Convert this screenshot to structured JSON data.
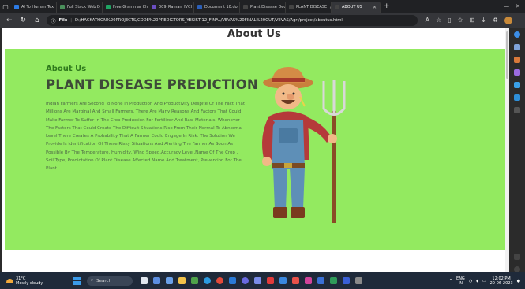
{
  "browser": {
    "tabs": [
      {
        "label": "AI To Human Tex",
        "color": "#2c7be5"
      },
      {
        "label": "Full Stack Web D",
        "color": "#4a8f5b"
      },
      {
        "label": "Free Grammar Ch",
        "color": "#1fa463"
      },
      {
        "label": "009_Raman_IVCH",
        "color": "#6b4ec2"
      },
      {
        "label": "Document 10.do",
        "color": "#2b5fb8"
      },
      {
        "label": "Plant Disease Dec",
        "color": "#444"
      },
      {
        "label": "PLANT DISEASE",
        "color": "#444"
      },
      {
        "label": "ABOUT US",
        "color": "#444"
      }
    ],
    "active_tab": 7,
    "new_tab": "+",
    "address": {
      "label": "File",
      "path": "D:/HACKATHON%20PROJECTS/CODE%20PREDICTORS_YESIST'12_FINAL/VEVAS%20FINAL%20OUT/VEVAS/Agri/project/aboutus.html"
    }
  },
  "page": {
    "title": "About Us",
    "eyebrow": "About Us",
    "headline": "PLANT DISEASE PREDICTION",
    "body": "Indian Farmers Are Second To None In Production And Productivity Despite Of The Fact That Millions Are Marginal And Small Farmers. There Are Many Reasons And Factors That Could Make Farmer To Suffer In The Crop Production For Fertilizer And Raw Materials. Whenever The Factors That Could Create The Difficult Situations Rise From Their Normal To Abnormal Level There Creates A Probability That A Farmer Could Engage In Risk. The Solution We Provide Is Identification Of These Risky Situations And Alerting The Farmer As Soon As Possible By The Temperature, Humidity, Wind Speed,Accuracy Level,Name Of The Crop , Soil Type, Predictation Of Plant Disease Affected Name And Treatment, Prevention For The Plant.",
    "illustration": "farmer-with-pitchfork",
    "colors": {
      "band": "#93ea60",
      "eyebrow": "#2f7a1d",
      "headline": "#3d4a38"
    }
  },
  "taskbar": {
    "weather_temp": "31°C",
    "weather_desc": "Mostly cloudy",
    "search_label": "Search",
    "lang_top": "ENG",
    "lang_bottom": "IN",
    "time": "12:02 PM",
    "date": "20-06-2023"
  }
}
